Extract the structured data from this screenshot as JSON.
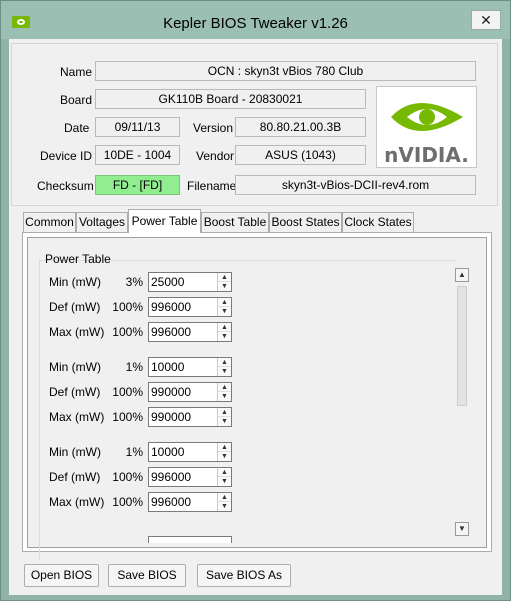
{
  "window": {
    "title": "Kepler BIOS Tweaker v1.26",
    "close_glyph": "✕"
  },
  "info": {
    "name_label": "Name",
    "name": "OCN : skyn3t vBios 780 Club",
    "board_label": "Board",
    "board": "GK110B Board - 20830021",
    "date_label": "Date",
    "date": "09/11/13",
    "version_label": "Version",
    "version": "80.80.21.00.3B",
    "device_label": "Device ID",
    "device": "10DE - 1004",
    "vendor_label": "Vendor",
    "vendor": "ASUS (1043)",
    "checksum_label": "Checksum",
    "checksum": "FD - [FD]",
    "filename_label": "Filename",
    "filename": "skyn3t-vBios-DCII-rev4.rom"
  },
  "logo": {
    "text": "nVIDIA."
  },
  "tabs": [
    "Common",
    "Voltages",
    "Power Table",
    "Boost Table",
    "Boost States",
    "Clock States"
  ],
  "active_tab": "Power Table",
  "power_table": {
    "title": "Power Table",
    "rows": [
      {
        "label": "Min (mW)",
        "pct": "3%",
        "value": "25000"
      },
      {
        "label": "Def (mW)",
        "pct": "100%",
        "value": "996000"
      },
      {
        "label": "Max (mW)",
        "pct": "100%",
        "value": "996000"
      },
      {
        "label": "Min (mW)",
        "pct": "1%",
        "value": "10000"
      },
      {
        "label": "Def (mW)",
        "pct": "100%",
        "value": "990000"
      },
      {
        "label": "Max (mW)",
        "pct": "100%",
        "value": "990000"
      },
      {
        "label": "Min (mW)",
        "pct": "1%",
        "value": "10000"
      },
      {
        "label": "Def (mW)",
        "pct": "100%",
        "value": "996000"
      },
      {
        "label": "Max (mW)",
        "pct": "100%",
        "value": "996000"
      }
    ]
  },
  "buttons": {
    "open": "Open BIOS",
    "save": "Save BIOS",
    "save_as": "Save BIOS As"
  },
  "colors": {
    "checksum_ok": "#90ee90",
    "nvidia_green": "#76b900"
  }
}
